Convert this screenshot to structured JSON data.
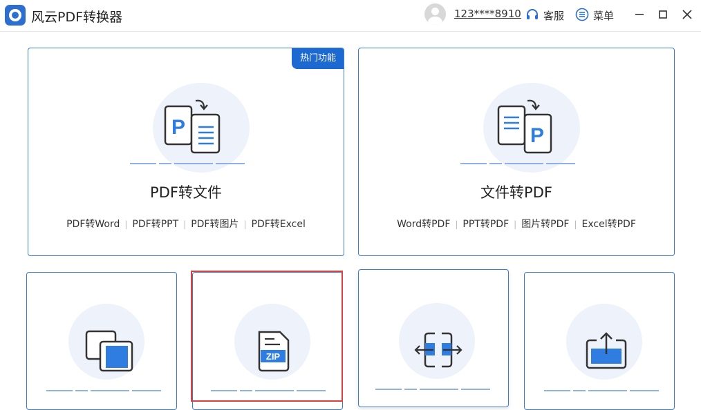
{
  "app": {
    "title": "风云PDF转换器",
    "username": "123****8910",
    "service_label": "客服",
    "menu_label": "菜单"
  },
  "cards": {
    "pdf_to_file": {
      "badge": "热门功能",
      "title": "PDF转文件",
      "links": [
        "PDF转Word",
        "PDF转PPT",
        "PDF转图片",
        "PDF转Excel"
      ]
    },
    "file_to_pdf": {
      "title": "文件转PDF",
      "links": [
        "Word转PDF",
        "PPT转PDF",
        "图片转PDF",
        "Excel转PDF"
      ]
    }
  },
  "icons": {
    "zip_label": "ZIP",
    "pdf_letter": "P"
  },
  "colors": {
    "accent": "#2c6fd1",
    "icon_fill": "#2f7de1",
    "selected": "#d94040",
    "badge": "#1d69d2"
  }
}
